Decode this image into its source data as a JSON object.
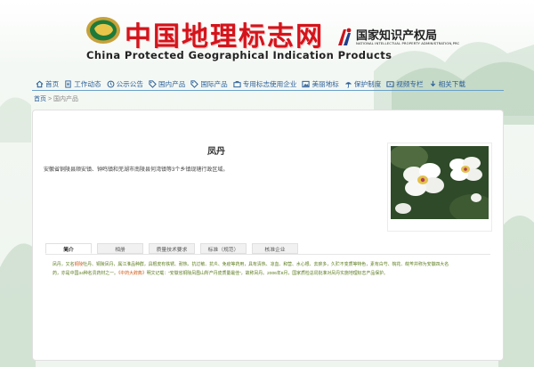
{
  "header": {
    "logo_cn": "中国地理标志网",
    "logo_en": "China Protected Geographical Indication Products",
    "agency_cn": "国家知识产权局",
    "agency_en": "NATIONAL INTELLECTUAL PROPERTY ADMINISTRATION,PRC"
  },
  "nav": {
    "items": [
      {
        "label": "首页",
        "icon": "home-icon"
      },
      {
        "label": "工作动态",
        "icon": "document-icon"
      },
      {
        "label": "公示公告",
        "icon": "bullhorn-icon"
      },
      {
        "label": "国内产品",
        "icon": "tag-icon"
      },
      {
        "label": "国际产品",
        "icon": "tag-icon"
      },
      {
        "label": "专用标志使用企业",
        "icon": "briefcase-icon"
      },
      {
        "label": "美丽地标",
        "icon": "image-icon"
      },
      {
        "label": "保护制度",
        "icon": "umbrella-icon"
      },
      {
        "label": "视频专栏",
        "icon": "video-icon"
      },
      {
        "label": "相关下载",
        "icon": "download-icon"
      }
    ]
  },
  "breadcrumb": {
    "home": "首页",
    "separator": ">",
    "current": "国内产品"
  },
  "product": {
    "title": "凤丹",
    "description": "安徽省铜陵县顺安镇、钟鸣镇和芜湖市南陵县何湾镇等3个乡镇现辖行政区域。"
  },
  "tabs": [
    {
      "label": "简介",
      "active": true
    },
    {
      "label": "相册",
      "active": false
    },
    {
      "label": "质量技术要求",
      "active": false
    },
    {
      "label": "标准（规范）",
      "active": false
    },
    {
      "label": "核准企业",
      "active": false
    }
  ],
  "body": {
    "line1_a": "凤丹，又名",
    "line1_hl": "铜陵",
    "line1_b": "牡丹、铜陵凤丹，属江淮品种群，具根皮有铁锈、耐热、抗过敏、抗炎、免疫等药用，具有清热、凉血、和营、水心根、去瘀多，久贮不变质等特色，素有白芍、皖花、皖芩并称为安徽四大名",
    "line2_a": "药，亦是中国34种名贵药材之一。",
    "line2_hl": "《中药大辞典》",
    "line2_b": "明文记载：“安徽省铜陵凤凰山所产丹皮质量最佳”，故称凤丹。2006年8月，国家质检总局批准对凤丹实施地理标志产品保护。"
  },
  "colors": {
    "nav_text": "#2a5f9a",
    "logo_red": "#d4141b",
    "body_green": "#5a7a1c",
    "highlight_orange": "#d05a14"
  }
}
